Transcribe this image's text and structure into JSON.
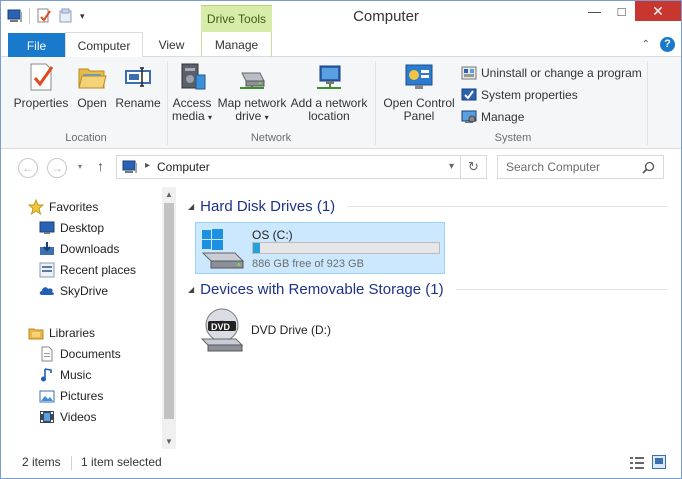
{
  "window": {
    "title": "Computer",
    "context_tab_group": "Drive Tools"
  },
  "ribbon_tabs": [
    {
      "label": "File"
    },
    {
      "label": "Computer"
    },
    {
      "label": "View"
    },
    {
      "label": "Manage"
    }
  ],
  "ribbon": {
    "location": {
      "label": "Location",
      "buttons": [
        {
          "label": "Properties"
        },
        {
          "label": "Open"
        },
        {
          "label": "Rename"
        }
      ]
    },
    "network": {
      "label": "Network",
      "access_media": [
        "Access",
        "media"
      ],
      "map_drive": [
        "Map network",
        "drive"
      ],
      "add_location": [
        "Add a network",
        "location"
      ]
    },
    "system": {
      "label": "System",
      "open_control_panel": [
        "Open Control",
        "Panel"
      ],
      "uninstall": "Uninstall or change a program",
      "system_properties": "System properties",
      "manage": "Manage"
    }
  },
  "address": {
    "path": "Computer",
    "search_placeholder": "Search Computer"
  },
  "nav": {
    "favorites": {
      "label": "Favorites",
      "items": [
        {
          "label": "Desktop"
        },
        {
          "label": "Downloads"
        },
        {
          "label": "Recent places"
        },
        {
          "label": "SkyDrive"
        }
      ]
    },
    "libraries": {
      "label": "Libraries",
      "items": [
        {
          "label": "Documents"
        },
        {
          "label": "Music"
        },
        {
          "label": "Pictures"
        },
        {
          "label": "Videos"
        }
      ]
    }
  },
  "content": {
    "hard_disk_group": "Hard Disk Drives (1)",
    "drive_os": {
      "name": "OS (C:)",
      "free_text": "886 GB free of 923 GB",
      "used_fraction": 0.04
    },
    "removable_group": "Devices with Removable Storage (1)",
    "dvd": {
      "name": "DVD Drive (D:)",
      "badge": "DVD"
    }
  },
  "status": {
    "item_count": "2 items",
    "selected": "1 item selected"
  },
  "colors": {
    "accent": "#1979ca",
    "close": "#c7372f",
    "context_tab": "#d7eca8",
    "selection": "#cce8ff",
    "group_heading": "#1e3287"
  }
}
